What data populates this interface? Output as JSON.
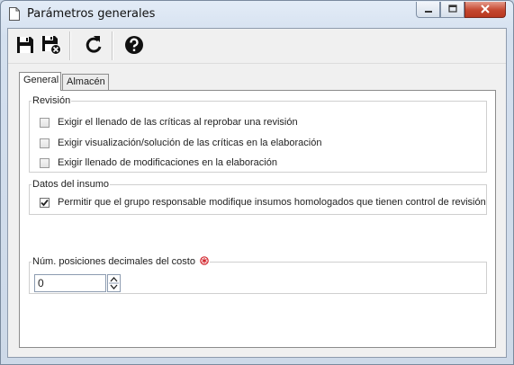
{
  "window": {
    "title": "Parámetros generales",
    "close_color": "#c4472f"
  },
  "toolbar": {
    "buttons": [
      {
        "icon": "save-icon"
      },
      {
        "icon": "save-and-close-icon"
      },
      {
        "icon": "refresh-icon"
      },
      {
        "icon": "help-icon"
      }
    ]
  },
  "tabs": [
    {
      "label": "General",
      "active": true
    },
    {
      "label": "Almacén",
      "active": false
    }
  ],
  "revision": {
    "legend": "Revisión",
    "options": [
      {
        "label": "Exigir el llenado de las críticas al reprobar una revisión",
        "checked": false
      },
      {
        "label": "Exigir visualización/solución de las críticas en la elaboración",
        "checked": false
      },
      {
        "label": "Exigir llenado de modificaciones en la elaboración",
        "checked": false
      }
    ]
  },
  "datos_insumo": {
    "legend": "Datos del insumo",
    "options": [
      {
        "label": "Permitir que el grupo responsable modifique insumos homologados que tienen control de revisión",
        "checked": true
      }
    ]
  },
  "decimales": {
    "legend": "Núm. posiciones decimales del costo",
    "required_icon": "required-icon",
    "value": "0"
  }
}
